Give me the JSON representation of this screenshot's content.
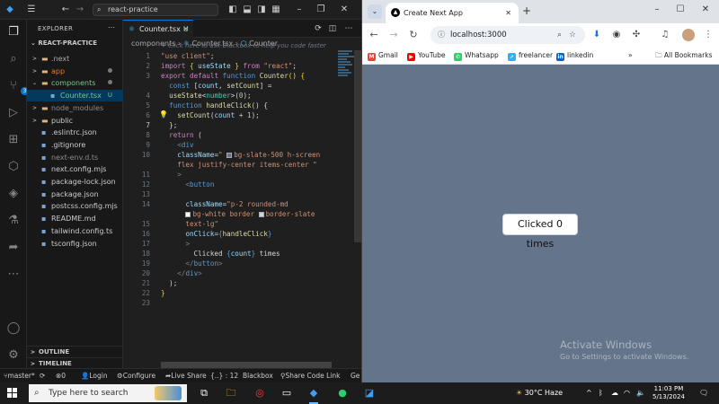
{
  "vscode": {
    "search_text": "react-practice",
    "explorer_label": "EXPLORER",
    "project_name": "REACT-PRACTICE",
    "tree": [
      {
        "label": ".next",
        "type": "folder",
        "open": false,
        "color": "#aaaaaa",
        "mark": ""
      },
      {
        "label": "app",
        "type": "folder",
        "open": false,
        "color": "#e37933",
        "mark": "dot"
      },
      {
        "label": "components",
        "type": "folder",
        "open": true,
        "color": "#73c991",
        "mark": "dot"
      },
      {
        "label": "Counter.tsx",
        "type": "file",
        "color": "#73c991",
        "mark": "U",
        "selected": true
      },
      {
        "label": "node_modules",
        "type": "folder",
        "open": false,
        "color": "#8c8c8c",
        "mark": ""
      },
      {
        "label": "public",
        "type": "folder",
        "open": false,
        "color": "#cccccc",
        "mark": ""
      },
      {
        "label": ".eslintrc.json",
        "type": "file",
        "color": "#cccccc",
        "mark": ""
      },
      {
        "label": ".gitignore",
        "type": "file",
        "color": "#cccccc",
        "mark": ""
      },
      {
        "label": "next-env.d.ts",
        "type": "file",
        "color": "#8c8c8c",
        "mark": ""
      },
      {
        "label": "next.config.mjs",
        "type": "file",
        "color": "#cccccc",
        "mark": ""
      },
      {
        "label": "package-lock.json",
        "type": "file",
        "color": "#cccccc",
        "mark": ""
      },
      {
        "label": "package.json",
        "type": "file",
        "color": "#cccccc",
        "mark": ""
      },
      {
        "label": "postcss.config.mjs",
        "type": "file",
        "color": "#cccccc",
        "mark": ""
      },
      {
        "label": "README.md",
        "type": "file",
        "color": "#cccccc",
        "mark": ""
      },
      {
        "label": "tailwind.config.ts",
        "type": "file",
        "color": "#cccccc",
        "mark": ""
      },
      {
        "label": "tsconfig.json",
        "type": "file",
        "color": "#cccccc",
        "mark": ""
      }
    ],
    "outline_label": "OUTLINE",
    "timeline_label": "TIMELINE",
    "tab": {
      "name": "Counter.tsx",
      "status": "U"
    },
    "breadcrumb": {
      "folder": "components",
      "file": "Counter.tsx",
      "symbol": "Counter"
    },
    "hint": "Click here to ask Blackbox to help you code faster",
    "line_numbers": [
      "1",
      "2",
      "3",
      "",
      "4",
      "5",
      "6",
      "7",
      "8",
      "9",
      "10",
      "",
      "11",
      "12",
      "13",
      "14",
      "",
      "15",
      "16",
      "17",
      "18",
      "19",
      "20",
      "21",
      "22",
      "23"
    ],
    "current_line": "7",
    "status": {
      "branch": "master*",
      "sync": "0",
      "errors": "0",
      "login": "Login",
      "configure": "Configure",
      "live_share": "Live Share",
      "position": "{..} : 12",
      "blackbox": "Blackbox",
      "share_code": "Share Code Link",
      "extra": "Ge"
    }
  },
  "chrome": {
    "tab_title": "Create Next App",
    "url": "localhost:3000",
    "bookmarks": [
      {
        "label": "Gmail",
        "color": "#ea4335",
        "glyph": "M"
      },
      {
        "label": "YouTube",
        "color": "#ff0000",
        "glyph": "▶"
      },
      {
        "label": "Whatsapp",
        "color": "#25d366",
        "glyph": "✆"
      },
      {
        "label": "freelancer",
        "color": "#29b2fe",
        "glyph": "➚"
      },
      {
        "label": "linkedin",
        "color": "#0a66c2",
        "glyph": "in"
      }
    ],
    "all_bookmarks": "All Bookmarks",
    "button_text": "Clicked 0 times",
    "activate_title": "Activate Windows",
    "activate_sub": "Go to Settings to activate Windows."
  },
  "taskbar": {
    "search_placeholder": "Type here to search",
    "weather": "30°C  Haze",
    "time": "11:03 PM",
    "date": "5/13/2024"
  }
}
